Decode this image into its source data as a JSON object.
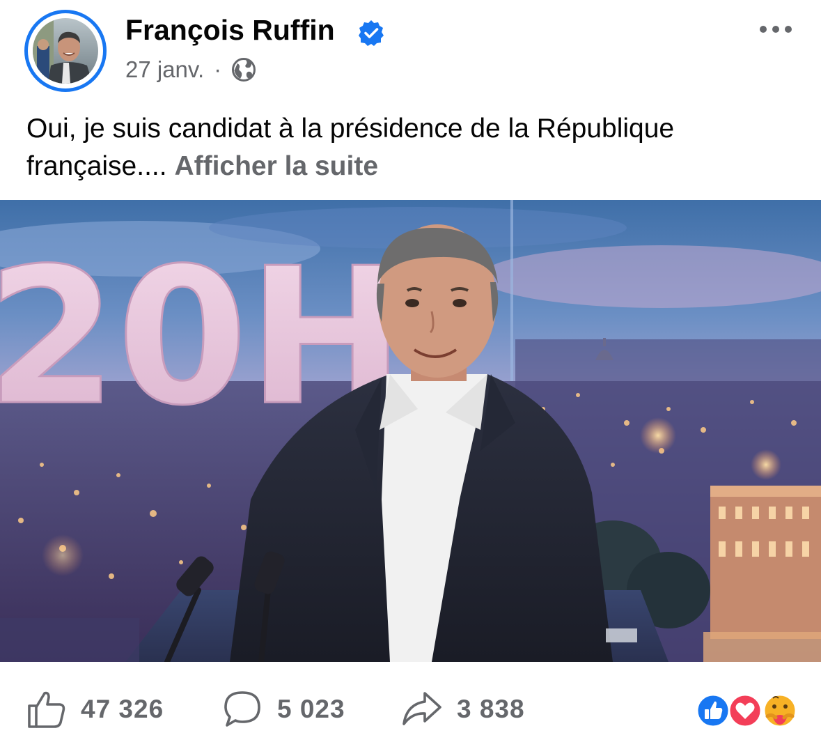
{
  "post": {
    "author": {
      "name": "François Ruffin",
      "verified": true,
      "avatar": "profile-photo"
    },
    "timestamp": "27 janv.",
    "separator": "·",
    "audience_icon": "globe-icon",
    "more_icon": "more-options-icon",
    "text": "Oui, je suis candidat à la présidence de la République française....",
    "see_more_label": "Afficher la suite",
    "image": {
      "description_icon": "tv-studio-photo",
      "studio_sign": "20H"
    },
    "actions": {
      "like": {
        "icon": "like-icon",
        "count": "47 326"
      },
      "comment": {
        "icon": "comment-icon",
        "count": "5 023"
      },
      "share": {
        "icon": "share-icon",
        "count": "3 838"
      }
    },
    "reactions": [
      "like-reaction-icon",
      "love-reaction-icon",
      "care-reaction-icon"
    ]
  },
  "colors": {
    "accent": "#1877f2",
    "text_primary": "#050505",
    "text_secondary": "#65676b",
    "love": "#f33e58",
    "care": "#f7b125"
  }
}
